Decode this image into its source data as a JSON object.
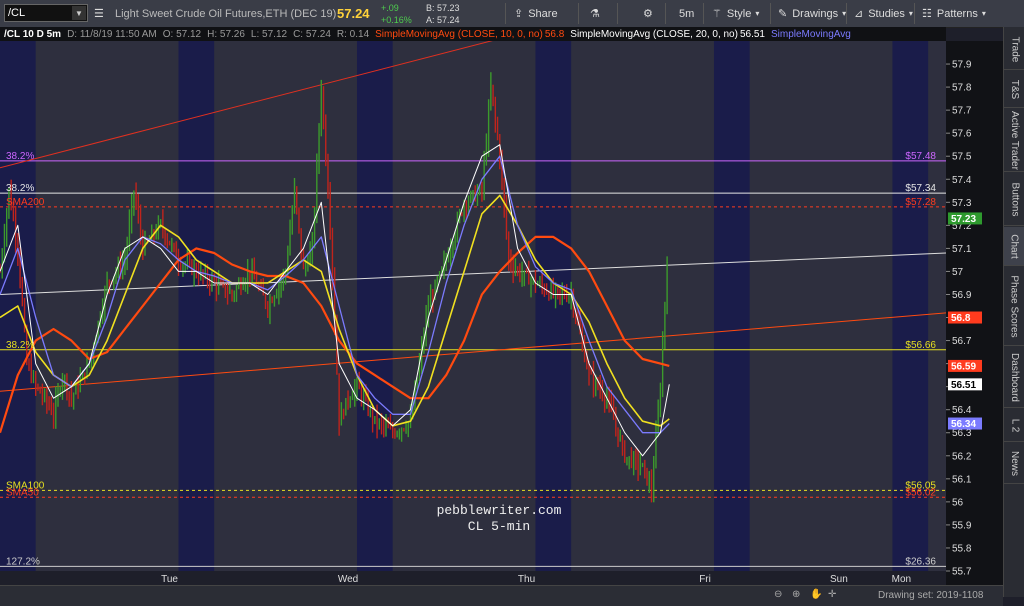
{
  "toolbar": {
    "symbol": "/CL",
    "description": "Light Sweet Crude Oil Futures,ETH (DEC 19)",
    "last": "57.24",
    "change": "+.09",
    "change_pct": "+0.16%",
    "bid": "B: 57.23",
    "ask": "A: 57.24",
    "share_label": "Share",
    "timeframe": "5m",
    "style_label": "Style",
    "drawings_label": "Drawings",
    "studies_label": "Studies",
    "patterns_label": "Patterns"
  },
  "infobar": {
    "symbol": "/CL 10 D 5m",
    "date": "D: 11/8/19 11:50 AM",
    "open": "O: 57.12",
    "high": "H: 57.26",
    "low": "L: 57.12",
    "close": "C: 57.24",
    "range": "R: 0.14",
    "sma10": "SimpleMovingAvg (CLOSE, 10, 0, no)",
    "sma10_val": "56.8",
    "sma20": "SimpleMovingAvg (CLOSE, 20, 0, no)",
    "sma20_val": "56.51",
    "sma_more": "SimpleMovingAvg"
  },
  "sidebar": [
    "Trade",
    "T&S",
    "Active Trader",
    "Buttons",
    "Chart",
    "Phase Scores",
    "Dashboard",
    "L 2",
    "News"
  ],
  "status": {
    "drawing_set": "Drawing set: 2019-1108"
  },
  "colors": {
    "sma10": "#ffffff",
    "sma20": "#7b7bff",
    "sma50": "#f0e020",
    "sma200": "#ff4a10",
    "up": "#3c9a2c",
    "down": "#c0241c",
    "fib": "#cc66ff"
  },
  "chart_data": {
    "type": "line",
    "ylim": [
      55.7,
      58.0
    ],
    "yticks": [
      55.7,
      55.8,
      55.9,
      56,
      56.1,
      56.2,
      56.3,
      56.4,
      56.5,
      56.6,
      56.7,
      56.8,
      56.9,
      57,
      57.1,
      57.2,
      57.3,
      57.4,
      57.5,
      57.6,
      57.7,
      57.8,
      57.9
    ],
    "xlabels": [
      {
        "label": "Tue",
        "t": 0.75
      },
      {
        "label": "Wed",
        "t": 1.75
      },
      {
        "label": "Thu",
        "t": 2.75
      },
      {
        "label": "Fri",
        "t": 3.75
      },
      {
        "label": "Sun",
        "t": 4.5
      },
      {
        "label": "Mon",
        "t": 4.85
      }
    ],
    "night_sessions": [
      [
        -0.2,
        0.0
      ],
      [
        0.8,
        1.0
      ],
      [
        1.8,
        2.0
      ],
      [
        2.8,
        3.0
      ],
      [
        3.8,
        4.0
      ],
      [
        4.8,
        5.0
      ]
    ],
    "xlim": [
      -0.2,
      5.1
    ],
    "price_path": [
      [
        -0.2,
        57.0
      ],
      [
        -0.15,
        57.35
      ],
      [
        -0.1,
        57.1
      ],
      [
        -0.05,
        56.6
      ],
      [
        0.0,
        56.5
      ],
      [
        0.05,
        56.45
      ],
      [
        0.1,
        56.38
      ],
      [
        0.15,
        56.55
      ],
      [
        0.2,
        56.45
      ],
      [
        0.3,
        56.6
      ],
      [
        0.4,
        56.95
      ],
      [
        0.5,
        57.05
      ],
      [
        0.55,
        57.35
      ],
      [
        0.6,
        57.1
      ],
      [
        0.7,
        57.2
      ],
      [
        0.8,
        57.05
      ],
      [
        0.9,
        57.0
      ],
      [
        1.0,
        56.95
      ],
      [
        1.1,
        56.9
      ],
      [
        1.2,
        57.0
      ],
      [
        1.3,
        56.85
      ],
      [
        1.4,
        57.0
      ],
      [
        1.45,
        57.35
      ],
      [
        1.5,
        57.0
      ],
      [
        1.55,
        57.1
      ],
      [
        1.6,
        57.8
      ],
      [
        1.65,
        57.2
      ],
      [
        1.7,
        56.35
      ],
      [
        1.75,
        56.45
      ],
      [
        1.8,
        56.5
      ],
      [
        1.9,
        56.35
      ],
      [
        2.0,
        56.3
      ],
      [
        2.1,
        56.35
      ],
      [
        2.2,
        56.85
      ],
      [
        2.3,
        57.05
      ],
      [
        2.4,
        57.3
      ],
      [
        2.5,
        57.35
      ],
      [
        2.55,
        57.8
      ],
      [
        2.6,
        57.5
      ],
      [
        2.65,
        57.05
      ],
      [
        2.7,
        57.0
      ],
      [
        2.8,
        56.95
      ],
      [
        2.9,
        56.9
      ],
      [
        3.0,
        56.9
      ],
      [
        3.1,
        56.55
      ],
      [
        3.2,
        56.45
      ],
      [
        3.3,
        56.2
      ],
      [
        3.4,
        56.15
      ],
      [
        3.45,
        56.05
      ],
      [
        3.5,
        56.5
      ],
      [
        3.55,
        57.24
      ]
    ],
    "sma10": [
      [
        -0.2,
        57.0
      ],
      [
        -0.1,
        57.2
      ],
      [
        0.0,
        56.6
      ],
      [
        0.1,
        56.45
      ],
      [
        0.2,
        56.5
      ],
      [
        0.3,
        56.6
      ],
      [
        0.4,
        56.9
      ],
      [
        0.5,
        57.1
      ],
      [
        0.6,
        57.15
      ],
      [
        0.7,
        57.1
      ],
      [
        0.8,
        57.0
      ],
      [
        0.9,
        57.0
      ],
      [
        1.0,
        56.95
      ],
      [
        1.1,
        56.95
      ],
      [
        1.2,
        56.95
      ],
      [
        1.3,
        56.9
      ],
      [
        1.4,
        57.0
      ],
      [
        1.5,
        57.1
      ],
      [
        1.6,
        57.3
      ],
      [
        1.7,
        56.6
      ],
      [
        1.8,
        56.45
      ],
      [
        1.9,
        56.4
      ],
      [
        2.0,
        56.33
      ],
      [
        2.1,
        56.4
      ],
      [
        2.2,
        56.8
      ],
      [
        2.3,
        57.05
      ],
      [
        2.4,
        57.3
      ],
      [
        2.5,
        57.5
      ],
      [
        2.6,
        57.55
      ],
      [
        2.7,
        57.1
      ],
      [
        2.8,
        56.95
      ],
      [
        2.9,
        56.9
      ],
      [
        3.0,
        56.9
      ],
      [
        3.1,
        56.6
      ],
      [
        3.2,
        56.45
      ],
      [
        3.3,
        56.3
      ],
      [
        3.4,
        56.2
      ],
      [
        3.5,
        56.3
      ],
      [
        3.55,
        56.51
      ]
    ],
    "sma20": [
      [
        -0.2,
        56.9
      ],
      [
        -0.1,
        57.1
      ],
      [
        0.0,
        56.8
      ],
      [
        0.1,
        56.55
      ],
      [
        0.2,
        56.5
      ],
      [
        0.3,
        56.6
      ],
      [
        0.4,
        56.8
      ],
      [
        0.5,
        57.05
      ],
      [
        0.6,
        57.15
      ],
      [
        0.7,
        57.12
      ],
      [
        0.8,
        57.05
      ],
      [
        0.9,
        57.0
      ],
      [
        1.0,
        56.98
      ],
      [
        1.1,
        56.95
      ],
      [
        1.2,
        56.95
      ],
      [
        1.3,
        56.92
      ],
      [
        1.4,
        56.98
      ],
      [
        1.5,
        57.05
      ],
      [
        1.6,
        57.15
      ],
      [
        1.7,
        56.85
      ],
      [
        1.8,
        56.55
      ],
      [
        1.9,
        56.45
      ],
      [
        2.0,
        56.38
      ],
      [
        2.1,
        56.38
      ],
      [
        2.2,
        56.65
      ],
      [
        2.3,
        56.95
      ],
      [
        2.4,
        57.2
      ],
      [
        2.5,
        57.4
      ],
      [
        2.6,
        57.5
      ],
      [
        2.7,
        57.2
      ],
      [
        2.8,
        57.02
      ],
      [
        2.9,
        56.95
      ],
      [
        3.0,
        56.92
      ],
      [
        3.1,
        56.7
      ],
      [
        3.2,
        56.5
      ],
      [
        3.3,
        56.4
      ],
      [
        3.4,
        56.3
      ],
      [
        3.5,
        56.3
      ],
      [
        3.55,
        56.34
      ]
    ],
    "sma50": [
      [
        -0.2,
        56.8
      ],
      [
        -0.1,
        56.85
      ],
      [
        0.0,
        56.65
      ],
      [
        0.1,
        56.55
      ],
      [
        0.2,
        56.5
      ],
      [
        0.3,
        56.55
      ],
      [
        0.4,
        56.7
      ],
      [
        0.5,
        56.9
      ],
      [
        0.6,
        57.1
      ],
      [
        0.7,
        57.2
      ],
      [
        0.8,
        57.15
      ],
      [
        0.9,
        57.05
      ],
      [
        1.0,
        57.0
      ],
      [
        1.1,
        56.95
      ],
      [
        1.2,
        56.95
      ],
      [
        1.3,
        56.95
      ],
      [
        1.4,
        57.0
      ],
      [
        1.5,
        57.05
      ],
      [
        1.6,
        57.0
      ],
      [
        1.7,
        56.75
      ],
      [
        1.8,
        56.55
      ],
      [
        1.9,
        56.4
      ],
      [
        2.0,
        56.33
      ],
      [
        2.1,
        56.35
      ],
      [
        2.2,
        56.5
      ],
      [
        2.3,
        56.75
      ],
      [
        2.4,
        57.0
      ],
      [
        2.5,
        57.25
      ],
      [
        2.6,
        57.33
      ],
      [
        2.7,
        57.2
      ],
      [
        2.8,
        57.05
      ],
      [
        2.9,
        56.95
      ],
      [
        3.0,
        56.9
      ],
      [
        3.1,
        56.78
      ],
      [
        3.2,
        56.6
      ],
      [
        3.3,
        56.45
      ],
      [
        3.4,
        56.35
      ],
      [
        3.5,
        56.33
      ],
      [
        3.55,
        56.36
      ]
    ],
    "sma200": [
      [
        -0.2,
        56.3
      ],
      [
        -0.1,
        56.55
      ],
      [
        0.0,
        56.7
      ],
      [
        0.1,
        56.75
      ],
      [
        0.2,
        56.7
      ],
      [
        0.3,
        56.62
      ],
      [
        0.4,
        56.65
      ],
      [
        0.5,
        56.75
      ],
      [
        0.6,
        56.85
      ],
      [
        0.7,
        56.95
      ],
      [
        0.8,
        57.05
      ],
      [
        0.9,
        57.1
      ],
      [
        1.0,
        57.08
      ],
      [
        1.1,
        57.03
      ],
      [
        1.2,
        57.0
      ],
      [
        1.3,
        56.98
      ],
      [
        1.4,
        56.98
      ],
      [
        1.5,
        56.95
      ],
      [
        1.6,
        56.85
      ],
      [
        1.7,
        56.7
      ],
      [
        1.8,
        56.6
      ],
      [
        1.9,
        56.55
      ],
      [
        2.0,
        56.5
      ],
      [
        2.1,
        56.45
      ],
      [
        2.2,
        56.45
      ],
      [
        2.3,
        56.55
      ],
      [
        2.4,
        56.7
      ],
      [
        2.5,
        56.9
      ],
      [
        2.6,
        57.0
      ],
      [
        2.7,
        57.08
      ],
      [
        2.8,
        57.15
      ],
      [
        2.9,
        57.15
      ],
      [
        3.0,
        57.1
      ],
      [
        3.1,
        57.0
      ],
      [
        3.2,
        56.85
      ],
      [
        3.3,
        56.7
      ],
      [
        3.4,
        56.62
      ],
      [
        3.5,
        56.6
      ],
      [
        3.55,
        56.59
      ]
    ],
    "hlines": [
      {
        "name": "fib-38-upper",
        "y": 57.48,
        "label_left": "38.2%",
        "label_right": "$57.48",
        "color": "#cc66ff",
        "dash": false
      },
      {
        "name": "fib-38-mid",
        "y": 57.34,
        "label_left": "38.2%",
        "label_right": "$57.34",
        "color": "#e6e6e6",
        "dash": false
      },
      {
        "name": "sma200-line",
        "y": 57.28,
        "label_left": "SMA200",
        "label_right": "$57.28",
        "color": "#ff3b1e",
        "dash": true
      },
      {
        "name": "fib-38-lower",
        "y": 56.66,
        "label_left": "38.2%",
        "label_right": "$56.66",
        "color": "#e6e020",
        "dash": false
      },
      {
        "name": "sma100-line",
        "y": 56.05,
        "label_left": "SMA100",
        "label_right": "$56.05",
        "color": "#e6e020",
        "dash": true
      },
      {
        "name": "sma50-line",
        "y": 56.02,
        "label_left": "SMA50",
        "label_right": "$56.02",
        "color": "#ff3b1e",
        "dash": true
      },
      {
        "name": "fib-bottom",
        "y": 55.72,
        "label_left": "127.2%",
        "label_right": "$26.36",
        "color": "#cccccc",
        "dash": false
      }
    ],
    "trendlines": [
      {
        "name": "red-top-trend",
        "x1": -0.2,
        "y1": 57.45,
        "x2": 3.55,
        "y2": 58.2,
        "color": "#e03020"
      },
      {
        "name": "white-trend",
        "x1": -0.2,
        "y1": 56.9,
        "x2": 5.1,
        "y2": 57.08,
        "color": "#dddddd"
      },
      {
        "name": "orange-trend",
        "x1": -0.2,
        "y1": 56.48,
        "x2": 5.1,
        "y2": 56.82,
        "color": "#ff4a10"
      }
    ],
    "price_badges": [
      {
        "name": "badge-last",
        "y": 57.23,
        "label": "57.23",
        "bg": "#2e9a2e",
        "fg": "#ffffff"
      },
      {
        "name": "badge-sma10",
        "y": 56.8,
        "label": "56.8",
        "bg": "#ff3b1e",
        "fg": "#ffffff"
      },
      {
        "name": "badge-sma200",
        "y": 56.59,
        "label": "56.59",
        "bg": "#ff3b1e",
        "fg": "#ffffff"
      },
      {
        "name": "badge-sma20",
        "y": 56.51,
        "label": "56.51",
        "bg": "#ffffff",
        "fg": "#000000"
      },
      {
        "name": "badge-sma50",
        "y": 56.34,
        "label": "56.34",
        "bg": "#7b7bff",
        "fg": "#ffffff"
      }
    ],
    "watermark": [
      "pebblewriter.com",
      "CL 5-min"
    ]
  }
}
